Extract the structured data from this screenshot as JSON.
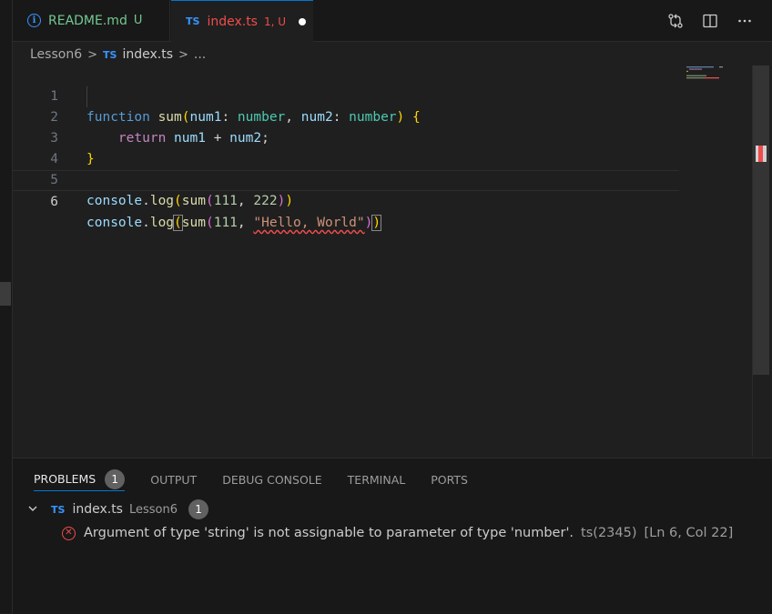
{
  "tabs": [
    {
      "name": "README.md",
      "badge": "U",
      "icon": "info-icon"
    },
    {
      "name": "index.ts",
      "badge": "1, U",
      "icon": "ts-icon",
      "icon_text": "TS",
      "active": true,
      "dirty": true
    }
  ],
  "breadcrumb": {
    "folder": "Lesson6",
    "file_icon": "TS",
    "file": "index.ts",
    "more": "..."
  },
  "editor": {
    "line_numbers": [
      "1",
      "2",
      "3",
      "4",
      "5",
      "6"
    ],
    "active_line": "6",
    "tokens": {
      "l1": {
        "kw": "function",
        "fn": "sum",
        "p1": "num1",
        "t1": "number",
        "p2": "num2",
        "t2": "number"
      },
      "l2": {
        "kw": "return",
        "a": "num1",
        "op": "+",
        "b": "num2"
      },
      "l5": {
        "obj": "console",
        "fn": "log",
        "call": "sum",
        "n1": "111",
        "n2": "222"
      },
      "l6": {
        "obj": "console",
        "fn": "log",
        "call": "sum",
        "n1": "111",
        "s": "\"Hello, World\""
      }
    }
  },
  "panel": {
    "tabs": [
      "PROBLEMS",
      "OUTPUT",
      "DEBUG CONSOLE",
      "TERMINAL",
      "PORTS"
    ],
    "problem_count": "1",
    "group": {
      "icon_text": "TS",
      "file": "index.ts",
      "folder": "Lesson6",
      "count": "1"
    },
    "problem": {
      "message": "Argument of type 'string' is not assignable to parameter of type 'number'.",
      "code": "ts(2345)",
      "location": "[Ln 6, Col 22]"
    }
  },
  "colors": {
    "accent": "#0078d4",
    "error": "#f14c4c",
    "untracked": "#73c991",
    "ts": "#3794ff"
  }
}
